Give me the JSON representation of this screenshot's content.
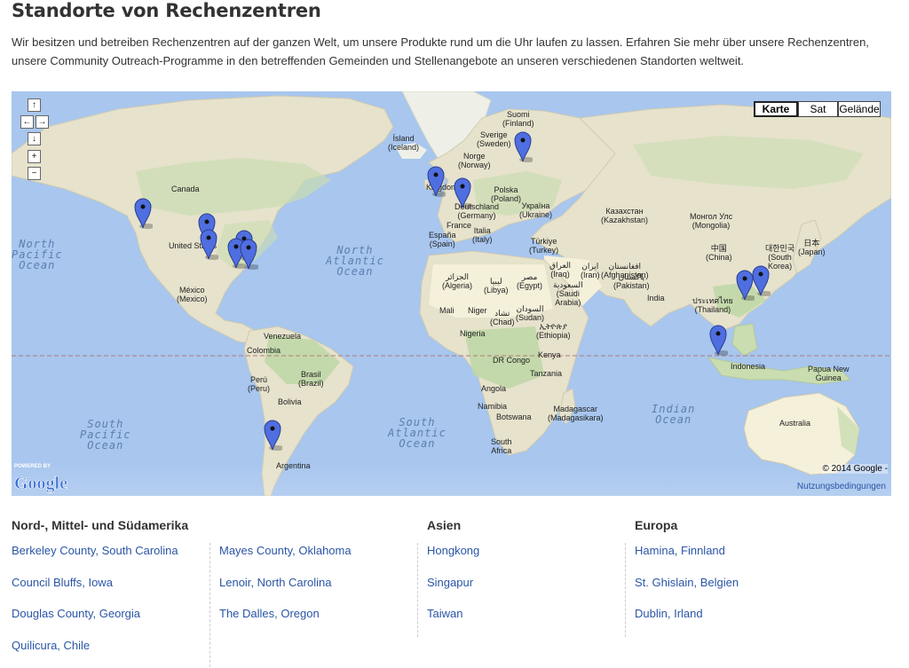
{
  "title": "Standorte von Rechenzentren",
  "intro": "Wir besitzen und betreiben Rechenzentren auf der ganzen Welt, um unsere Produkte rund um die Uhr laufen zu lassen. Erfahren Sie mehr über unsere Rechenzentren, unsere Community Outreach-Programme in den betreffenden Gemeinden und Stellenangebote an unseren verschiedenen Standorten weltweit.",
  "map": {
    "types": [
      "Karte",
      "Sat",
      "Gelände"
    ],
    "active_type": "Karte",
    "powered_by": "POWERED BY",
    "logo": "Google",
    "copyright": "© 2014 Google -",
    "terms": "Nutzungsbedingungen",
    "controls": {
      "up": "↑",
      "left": "←",
      "right": "→",
      "down": "↓",
      "zoom_in": "+",
      "zoom_out": "−"
    },
    "labels": {
      "suomi": "Suomi\n(Finland)",
      "sverige": "Sverige\n(Sweden)",
      "norge": "Norge\n(Norway)",
      "island": "Ísland\n(Iceland)",
      "kingdom": "Kingdom",
      "polska": "Polska\n(Poland)",
      "ukraina": "Україна\n(Ukraine)",
      "deutschland": "Deutschland\n(Germany)",
      "france": "France",
      "espana": "España\n(Spain)",
      "italia": "Italia\n(Italy)",
      "turkiye": "Türkiye\n(Turkey)",
      "kazakhstan": "Казахстан\n(Kazakhstan)",
      "mongolia": "Монгол Улс\n(Mongolia)",
      "china": "中国\n(China)",
      "korea": "대한민국\n(South\nKorea)",
      "japan": "日本\n(Japan)",
      "iraq": "العراق\n(Iraq)",
      "iran": "ایران\n(Iran)",
      "afghanistan": "افغانستان\n(Afghanistan)",
      "pakistan": "پاکستان\n(Pakistan)",
      "saudi": "السعودية\n(Saudi\nArabia)",
      "india": "India",
      "thailand": "ประเทศไทย\n(Thailand)",
      "algeria": "الجزائر\n(Algeria)",
      "libya": "ليبيا\n(Libya)",
      "egypt": "مصر\n(Egypt)",
      "mali": "Mali",
      "niger": "Niger",
      "chad": "تشاد\n(Chad)",
      "sudan": "السودان\n(Sudan)",
      "ethiopia": "ኢትዮጵያ\n(Ethiopia)",
      "nigeria": "Nigeria",
      "drcongo": "DR Congo",
      "kenya": "Kenya",
      "tanzania": "Tanzania",
      "angola": "Angola",
      "namibia": "Namibia",
      "botswana": "Botswana",
      "madagascar": "Madagascar\n(Madagasikara)",
      "southafrica": "South\nAfrica",
      "indonesia": "Indonesia",
      "papua": "Papua New\nGuinea",
      "australia": "Australia",
      "canada": "Canada",
      "usa": "United States",
      "mexico": "México\n(Mexico)",
      "venezuela": "Venezuela",
      "colombia": "Colombia",
      "peru": "Perú\n(Peru)",
      "brasil": "Brasil\n(Brazil)",
      "bolivia": "Bolivia",
      "argentina": "Argentina"
    },
    "oceans": {
      "north_pacific": "North\nPacific\nOcean",
      "north_atlantic": "North\nAtlantic\nOcean",
      "south_pacific": "South\nPacific\nOcean",
      "south_atlantic": "South\nAtlantic\nOcean",
      "indian": "Indian\nOcean"
    }
  },
  "regions": {
    "americas": {
      "heading": "Nord-, Mittel- und Südamerika",
      "col1": [
        "Berkeley County, South Carolina",
        "Council Bluffs, Iowa",
        "Douglas County, Georgia",
        "Quilicura, Chile"
      ],
      "col2": [
        "Mayes County, Oklahoma",
        "Lenoir, North Carolina",
        "The Dalles, Oregon"
      ]
    },
    "asia": {
      "heading": "Asien",
      "items": [
        "Hongkong",
        "Singapur",
        "Taiwan"
      ]
    },
    "europe": {
      "heading": "Europa",
      "items": [
        "Hamina, Finnland",
        "St. Ghislain, Belgien",
        "Dublin, Irland"
      ]
    }
  },
  "colors": {
    "ocean": "#a8c6ee",
    "land": "#e6e2cc",
    "desert": "#f5f0da",
    "forest": "#bcd7a2",
    "marker": "#4f6ee0",
    "link": "#2a55a5"
  }
}
